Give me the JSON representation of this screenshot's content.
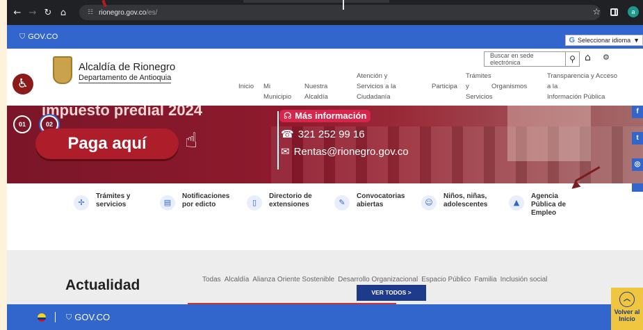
{
  "browser": {
    "url_host": "rionegro.gov.co",
    "url_path": "/es/",
    "profile_initial": "a"
  },
  "govbar": {
    "logo_text": "GOV.CO",
    "language_label": "Seleccionar idioma"
  },
  "header": {
    "title": "Alcaldía de Rionegro",
    "subtitle": "Departamento de Antioquia",
    "search_placeholder": "Buscar en sede electrónica",
    "menu": [
      "Inicio",
      "Mi\nMunicipio",
      "Nuestra\nAlcaldía",
      "Atención y\nServicios a la\nCiudadanía",
      "Participa",
      "Trámites\ny\nServicios",
      "Organismos",
      "Transparencia y Acceso\na la\nInformación Pública"
    ]
  },
  "hero": {
    "slide_1": "01",
    "slide_2": "02",
    "headline": "impuesto predial 2024",
    "pay_button": "Paga aquí",
    "more_info": "Más información",
    "phone": "321 252 99 16",
    "email": "Rentas@rionegro.gov.co"
  },
  "quick_access": [
    {
      "icon": "pointer-icon",
      "label": "Trámites y\nservicios"
    },
    {
      "icon": "document-icon",
      "label": "Notificaciones\npor edicto"
    },
    {
      "icon": "book-icon",
      "label": "Directorio de\nextensiones"
    },
    {
      "icon": "megaphone-icon",
      "label": "Convocatorias\nabiertas"
    },
    {
      "icon": "face-icon",
      "label": "Niños, niñas,\nadolescentes"
    },
    {
      "icon": "people-icon",
      "label": "Agencia\nPública de\nEmpleo"
    }
  ],
  "news": {
    "title": "Actualidad",
    "categories": [
      "Todas",
      "Alcaldía",
      "Alianza Oriente Sostenible",
      "Desarrollo Organizacional",
      "Espacio Público",
      "Familia",
      "Inclusión social"
    ],
    "see_all": "VER TODOS  >"
  },
  "footer": {
    "logo_text": "GOV.CO",
    "back_to_top": "Volver al Inicio"
  },
  "colors": {
    "gov_blue": "#3366cc",
    "hero_red": "#8f1a2e",
    "cta_yellow": "#f0c540"
  }
}
